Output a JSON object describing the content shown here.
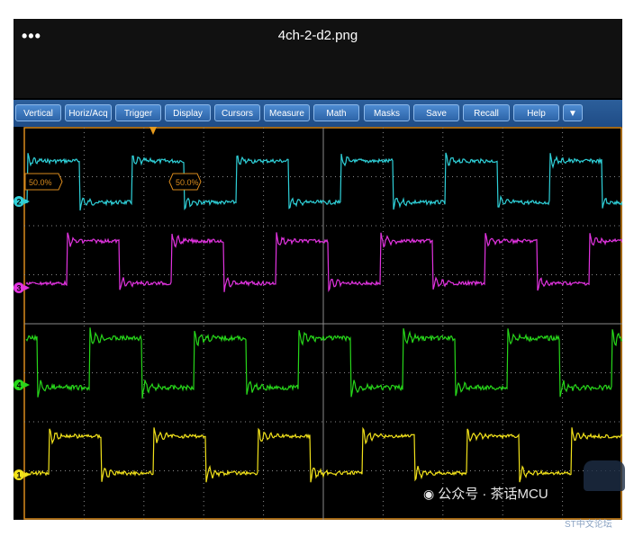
{
  "window": {
    "title": "4ch-2-d2.png",
    "more_icon": "more-dots-icon"
  },
  "menubar": {
    "items": [
      "Vertical",
      "Horiz/Acq",
      "Trigger",
      "Display",
      "Cursors",
      "Measure",
      "Math",
      "Masks",
      "Save",
      "Recall",
      "Help"
    ],
    "overflow_icon": "triangle-down-icon",
    "overflow_glyph": "▼"
  },
  "scope": {
    "trigger_marker_icon": "trigger-position-icon",
    "level_labels": [
      "50.0%",
      "50.0%"
    ],
    "channels": [
      {
        "label": "2",
        "color": "#2fd0d8"
      },
      {
        "label": "3",
        "color": "#e233e0"
      },
      {
        "label": "4",
        "color": "#27d61a"
      },
      {
        "label": "1",
        "color": "#f2e21a"
      }
    ]
  },
  "watermark": {
    "icon": "wechat-icon",
    "text": "公众号 · 茶话MCU"
  },
  "corner": {
    "text": "ST中文论坛"
  },
  "colors": {
    "menubar": "#1f4c86",
    "menu_button": "#3a75bd",
    "grid": "#8a8a8a",
    "border": "#d98a1c",
    "trigger_marker": "#e79a1c"
  }
}
